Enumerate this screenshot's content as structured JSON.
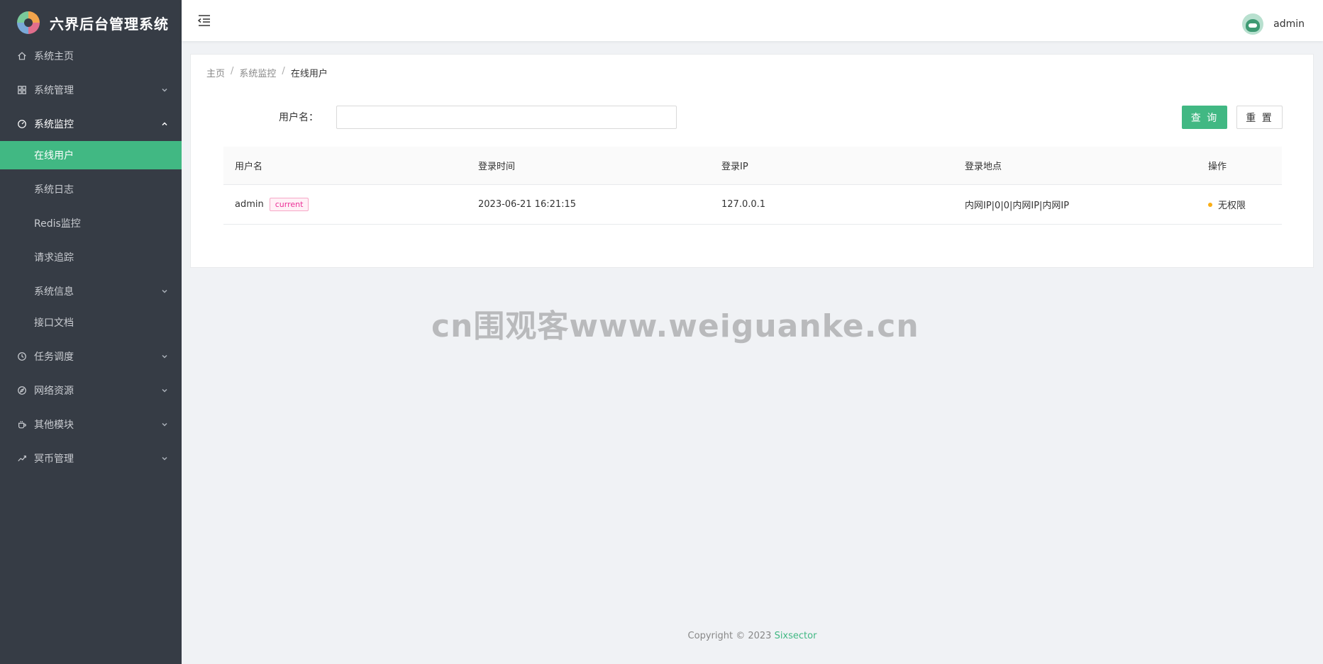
{
  "app": {
    "title": "六界后台管理系统"
  },
  "sidebar": {
    "items": [
      {
        "label": "系统主页"
      },
      {
        "label": "系统管理"
      },
      {
        "label": "系统监控"
      },
      {
        "label": "任务调度"
      },
      {
        "label": "网络资源"
      },
      {
        "label": "其他模块"
      },
      {
        "label": "冥币管理"
      }
    ],
    "monitor_sub": [
      {
        "label": "在线用户"
      },
      {
        "label": "系统日志"
      },
      {
        "label": "Redis监控"
      },
      {
        "label": "请求追踪"
      },
      {
        "label": "系统信息"
      },
      {
        "label": "接口文档"
      }
    ]
  },
  "header": {
    "username": "admin"
  },
  "breadcrumb": {
    "home": "主页",
    "parent": "系统监控",
    "current": "在线用户",
    "separator": "/"
  },
  "search": {
    "username_label": "用户名：",
    "username_value": "",
    "query_button": "查 询",
    "reset_button": "重 置"
  },
  "table": {
    "columns": [
      "用户名",
      "登录时间",
      "登录IP",
      "登录地点",
      "操作"
    ],
    "rows": [
      {
        "username": "admin",
        "tag": "current",
        "login_time": "2023-06-21 16:21:15",
        "login_ip": "127.0.0.1",
        "location": "内网IP|0|0|内网IP|内网IP",
        "action": "无权限"
      }
    ]
  },
  "watermark": "cn围观客www.weiguanke.cn",
  "footer": {
    "prefix": "Copyright © 2023 ",
    "brand": "Sixsector"
  },
  "colors": {
    "accent": "#41b883",
    "sidebar_bg": "#363c45",
    "tag_pink": "#eb2f96",
    "warning_dot": "#faad14"
  }
}
